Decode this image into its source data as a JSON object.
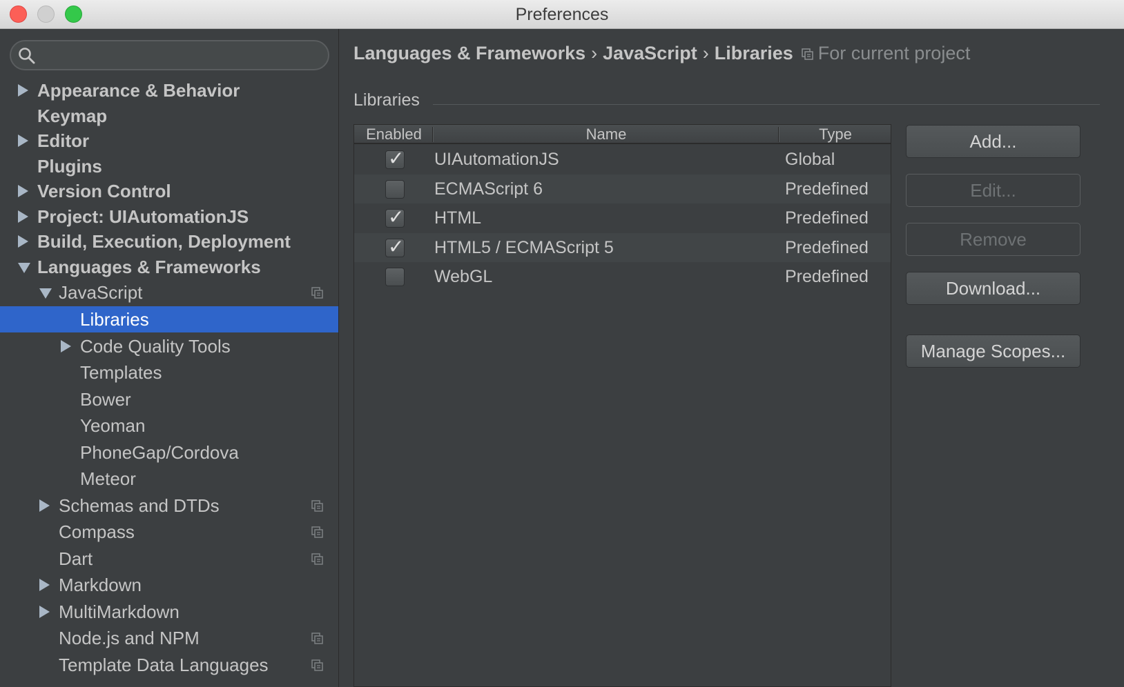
{
  "window": {
    "title": "Preferences"
  },
  "search": {
    "placeholder": ""
  },
  "sidebar": {
    "items": [
      {
        "label": "Appearance & Behavior",
        "arrow": "right"
      },
      {
        "label": "Keymap",
        "arrow": ""
      },
      {
        "label": "Editor",
        "arrow": "right"
      },
      {
        "label": "Plugins",
        "arrow": ""
      },
      {
        "label": "Version Control",
        "arrow": "right"
      },
      {
        "label": "Project: UIAutomationJS",
        "arrow": "right"
      },
      {
        "label": "Build, Execution, Deployment",
        "arrow": "right"
      },
      {
        "label": "Languages & Frameworks",
        "arrow": "down"
      },
      {
        "label": "JavaScript",
        "arrow": "down",
        "project_icon": true
      },
      {
        "label": "Libraries",
        "selected": true
      },
      {
        "label": "Code Quality Tools",
        "arrow": "right"
      },
      {
        "label": "Templates"
      },
      {
        "label": "Bower"
      },
      {
        "label": "Yeoman"
      },
      {
        "label": "PhoneGap/Cordova"
      },
      {
        "label": "Meteor"
      },
      {
        "label": "Schemas and DTDs",
        "arrow": "right",
        "project_icon": true
      },
      {
        "label": "Compass",
        "project_icon": true
      },
      {
        "label": "Dart",
        "project_icon": true
      },
      {
        "label": "Markdown",
        "arrow": "right"
      },
      {
        "label": "MultiMarkdown",
        "arrow": "right"
      },
      {
        "label": "Node.js and NPM",
        "project_icon": true
      },
      {
        "label": "Template Data Languages",
        "project_icon": true
      }
    ]
  },
  "breadcrumb": {
    "items": [
      "Languages & Frameworks",
      "JavaScript",
      "Libraries"
    ],
    "separator": "›",
    "scope": "For current project"
  },
  "libraries": {
    "group_title": "Libraries",
    "columns": [
      "Enabled",
      "Name",
      "Type"
    ],
    "rows": [
      {
        "enabled": true,
        "name": "UIAutomationJS",
        "type": "Global"
      },
      {
        "enabled": false,
        "name": "ECMAScript 6",
        "type": "Predefined"
      },
      {
        "enabled": true,
        "name": "HTML",
        "type": "Predefined"
      },
      {
        "enabled": true,
        "name": "HTML5 / ECMAScript 5",
        "type": "Predefined"
      },
      {
        "enabled": false,
        "name": "WebGL",
        "type": "Predefined"
      }
    ]
  },
  "buttons": {
    "add": "Add...",
    "edit": "Edit...",
    "remove": "Remove",
    "download": "Download...",
    "manage_scopes": "Manage Scopes..."
  },
  "colors": {
    "background": "#3c3f41",
    "selection": "#2f65ca",
    "text": "#c5c5c5"
  }
}
